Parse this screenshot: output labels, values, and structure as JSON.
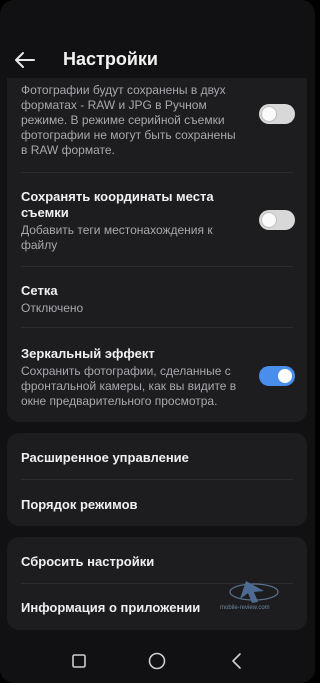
{
  "header": {
    "title": "Настройки",
    "back_icon": "arrow-left-icon"
  },
  "card1": {
    "raw_setting": {
      "subtitle_lines": [
        "Фотографии будут сохранены в двух",
        "форматах - RAW и JPG в Ручном",
        "режиме. В режиме серийной съемки",
        "фотографии не могут быть сохранены",
        "в RAW формате."
      ],
      "toggle": "off"
    },
    "location": {
      "title_lines": [
        "Сохранять координаты места",
        "съемки"
      ],
      "subtitle_lines": [
        "Добавить теги местонахождения к",
        "файлу"
      ],
      "toggle": "off"
    },
    "grid": {
      "title": "Сетка",
      "subtitle": "Отключено"
    },
    "mirror": {
      "title": "Зеркальный эффект",
      "subtitle_lines": [
        "Сохранить фотографии, сделанные с",
        "фронтальной камеры, как вы видите в",
        "окне предварительного просмотра."
      ],
      "toggle": "on"
    }
  },
  "card2": {
    "advanced": "Расширенное управление",
    "mode_order": "Порядок режимов"
  },
  "card3": {
    "reset": "Сбросить настройки",
    "about": "Информация о приложении"
  },
  "watermark": {
    "text": "mobile-review.com"
  },
  "navbar": {
    "recent_icon": "square-icon",
    "home_icon": "circle-icon",
    "back_icon": "triangle-back-icon"
  },
  "colors": {
    "background": "#111113",
    "card": "#1d1d20",
    "accent_toggle": "#4a8dea",
    "subtitle": "#a9a9ad"
  }
}
